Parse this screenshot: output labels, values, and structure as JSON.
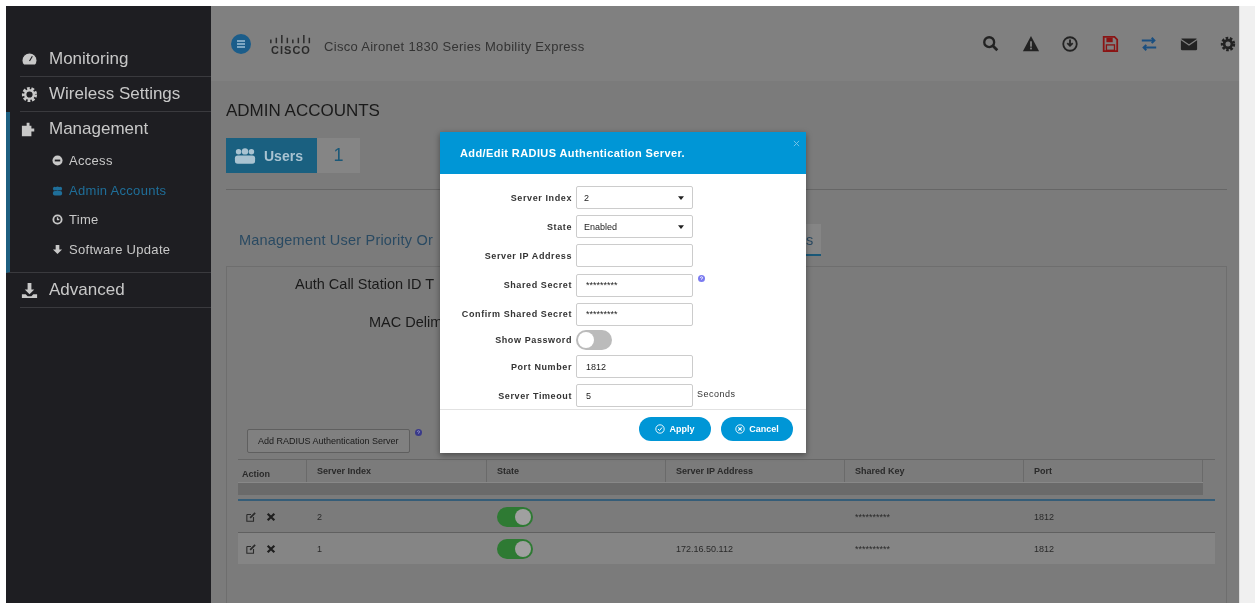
{
  "sidebar": {
    "items": [
      {
        "label": "Monitoring",
        "expanded": false
      },
      {
        "label": "Wireless Settings",
        "expanded": false
      },
      {
        "label": "Management",
        "expanded": true,
        "children": [
          {
            "label": "Access",
            "selected": false
          },
          {
            "label": "Admin Accounts",
            "selected": true
          },
          {
            "label": "Time",
            "selected": false
          },
          {
            "label": "Software Update",
            "selected": false
          }
        ]
      },
      {
        "label": "Advanced",
        "expanded": false
      }
    ]
  },
  "header": {
    "logo": "CISCO",
    "title": "Cisco Aironet 1830 Series Mobility Express"
  },
  "page_title": "ADMIN ACCOUNTS",
  "users_badge": {
    "label": "Users",
    "count": "1"
  },
  "tabs": [
    {
      "label": "Management User Priority Or",
      "selected": false
    },
    {
      "label": "s",
      "selected": true
    }
  ],
  "panel": {
    "labels": [
      "Auth Call Station ID T",
      "MAC Delim"
    ],
    "add_button": "Add RADIUS Authentication Server"
  },
  "table": {
    "columns": [
      "Action",
      "Server Index",
      "State",
      "Server IP Address",
      "Shared Key",
      "Port"
    ],
    "rows": [
      {
        "server_index": "2",
        "state_on": true,
        "ip": "",
        "shared_key": "**********",
        "port": "1812"
      },
      {
        "server_index": "1",
        "state_on": true,
        "ip": "172.16.50.112",
        "shared_key": "**********",
        "port": "1812"
      }
    ]
  },
  "dialog": {
    "title": "Add/Edit RADIUS Authentication Server.",
    "fields": [
      {
        "kind": "select",
        "label": "Server Index",
        "value": "2"
      },
      {
        "kind": "select",
        "label": "State",
        "value": "Enabled"
      },
      {
        "kind": "input",
        "label": "Server IP Address"
      },
      {
        "kind": "input",
        "label": "Shared Secret",
        "value": "*********",
        "help": true
      },
      {
        "kind": "input",
        "label": "Confirm Shared Secret",
        "value": "*********"
      },
      {
        "kind": "toggle",
        "label": "Show Password",
        "on": false
      },
      {
        "kind": "input",
        "label": "Port Number",
        "value": "1812"
      },
      {
        "kind": "input",
        "label": "Server Timeout",
        "value": "5",
        "suffix": "Seconds"
      }
    ],
    "buttons": [
      {
        "kind": "apply",
        "label": "Apply"
      },
      {
        "kind": "cancel",
        "label": "Cancel"
      }
    ]
  }
}
